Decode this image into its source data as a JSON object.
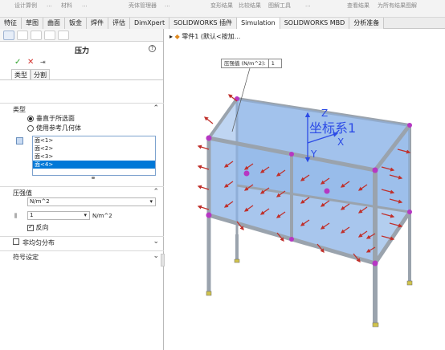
{
  "ribbon": {
    "items": [
      "设计算例",
      "...",
      "材料",
      "...",
      "壳体管理器",
      "...",
      "变形结果",
      "比较结果",
      "图解工具",
      "...",
      "为所有结果图解",
      "查看结果"
    ]
  },
  "tabs": [
    "特征",
    "草图",
    "曲面",
    "钣金",
    "焊件",
    "评估",
    "DimXpert",
    "SOLIDWORKS 插件",
    "Simulation",
    "SOLIDWORKS MBD",
    "分析准备"
  ],
  "property_manager": {
    "title": "压力",
    "help": "?",
    "confirm": "✓",
    "cancel": "✕",
    "pin": "⇥",
    "subtabs": [
      "类型",
      "分割"
    ],
    "type_section": {
      "label": "类型",
      "options": [
        "垂直于所选面",
        "使用参考几何体"
      ],
      "selected": 0
    },
    "faces": [
      "面<1>",
      "面<2>",
      "面<3>",
      "面<4>"
    ],
    "selected_face": 3,
    "pressure_section": {
      "label": "压强值",
      "unit": "N/m^2",
      "value": "1",
      "unit_suffix": "N/m^2",
      "reverse_label": "反向",
      "reverse_checked": true
    },
    "nonuniform_label": "非均匀分布",
    "symbol_label": "符号设定"
  },
  "viewport": {
    "breadcrumb": "零件1 (默认<按加...",
    "tooltip_label": "压强值 (N/m^2):",
    "tooltip_value": "1",
    "coord_label": "坐标系1",
    "axis_x": "X",
    "axis_y": "Y",
    "axis_z": "Z",
    "colors": {
      "frame": "#9aa3ad",
      "panel": "#8bb3e7",
      "arrow": "#c0302b",
      "joint": "#b637c3",
      "coord": "#2c4be6"
    }
  }
}
